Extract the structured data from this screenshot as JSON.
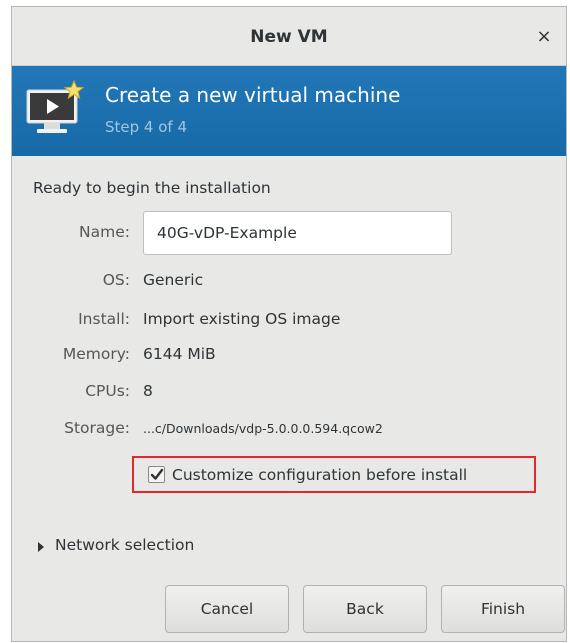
{
  "window": {
    "title": "New VM",
    "close_label": "×"
  },
  "banner": {
    "title": "Create a new virtual machine",
    "step": "Step 4 of 4",
    "accent_color": "#1c6fae"
  },
  "summary": {
    "intro": "Ready to begin the installation",
    "name_label": "Name:",
    "name_value": "40G-vDP-Example",
    "os_label": "OS:",
    "os_value": "Generic",
    "install_label": "Install:",
    "install_value": "Import existing OS image",
    "memory_label": "Memory:",
    "memory_value": "6144 MiB",
    "cpus_label": "CPUs:",
    "cpus_value": "8",
    "storage_label": "Storage:",
    "storage_value": "...c/Downloads/vdp-5.0.0.0.594.qcow2"
  },
  "customize": {
    "label": "Customize configuration before install",
    "checked": true,
    "highlight_color": "#e0282e"
  },
  "network": {
    "label": "Network selection",
    "expanded": false
  },
  "buttons": {
    "cancel": "Cancel",
    "back": "Back",
    "finish": "Finish"
  }
}
